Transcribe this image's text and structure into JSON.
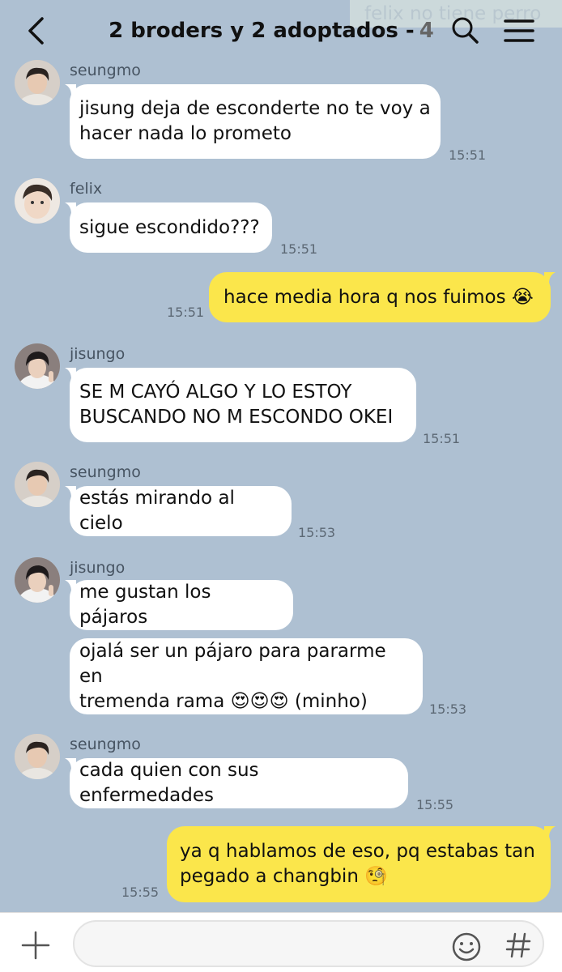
{
  "header": {
    "faded_preview": "felix no tiene perro",
    "title": "2 broders y 2 adoptados -",
    "member_count": "4",
    "icons": [
      "back-icon",
      "search-icon",
      "menu-icon"
    ]
  },
  "messages": [
    {
      "sender": "seungmo",
      "text": "jisung deja de esconderte no te voy a\nhacer nada lo prometo",
      "time": "15:51",
      "direction": "in",
      "avatar": "seungmo"
    },
    {
      "sender": "felix",
      "text": "sigue escondido???",
      "time": "15:51",
      "direction": "in",
      "avatar": "felix"
    },
    {
      "text": "hace media hora q nos fuimos 😭",
      "time": "15:51",
      "direction": "out"
    },
    {
      "sender": "jisungo",
      "text": "SE M CAYÓ ALGO Y LO ESTOY\nBUSCANDO NO M ESCONDO OKEI",
      "time": "15:51",
      "direction": "in",
      "avatar": "jisungo"
    },
    {
      "sender": "seungmo",
      "text": "estás mirando al cielo",
      "time": "15:53",
      "direction": "in",
      "avatar": "seungmo"
    },
    {
      "sender": "jisungo",
      "text": "me gustan los pájaros",
      "direction": "in",
      "avatar": "jisungo"
    },
    {
      "text": "ojalá ser un pájaro para pararme en\ntremenda rama 😍😍😍 (minho)",
      "time": "15:53",
      "direction": "in"
    },
    {
      "sender": "seungmo",
      "text": "cada quien con sus enfermedades",
      "time": "15:55",
      "direction": "in",
      "avatar": "seungmo"
    },
    {
      "text": "ya q hablamos de eso, pq estabas tan\npegado a changbin 🧐",
      "time": "15:55",
      "direction": "out"
    }
  ],
  "input_bar": {
    "placeholder": "",
    "icons": [
      "plus-icon",
      "emoji-icon",
      "hashtag-icon"
    ]
  },
  "colors": {
    "background": "#aec0d2",
    "incoming_bubble": "#ffffff",
    "outgoing_bubble": "#fbe64b"
  }
}
